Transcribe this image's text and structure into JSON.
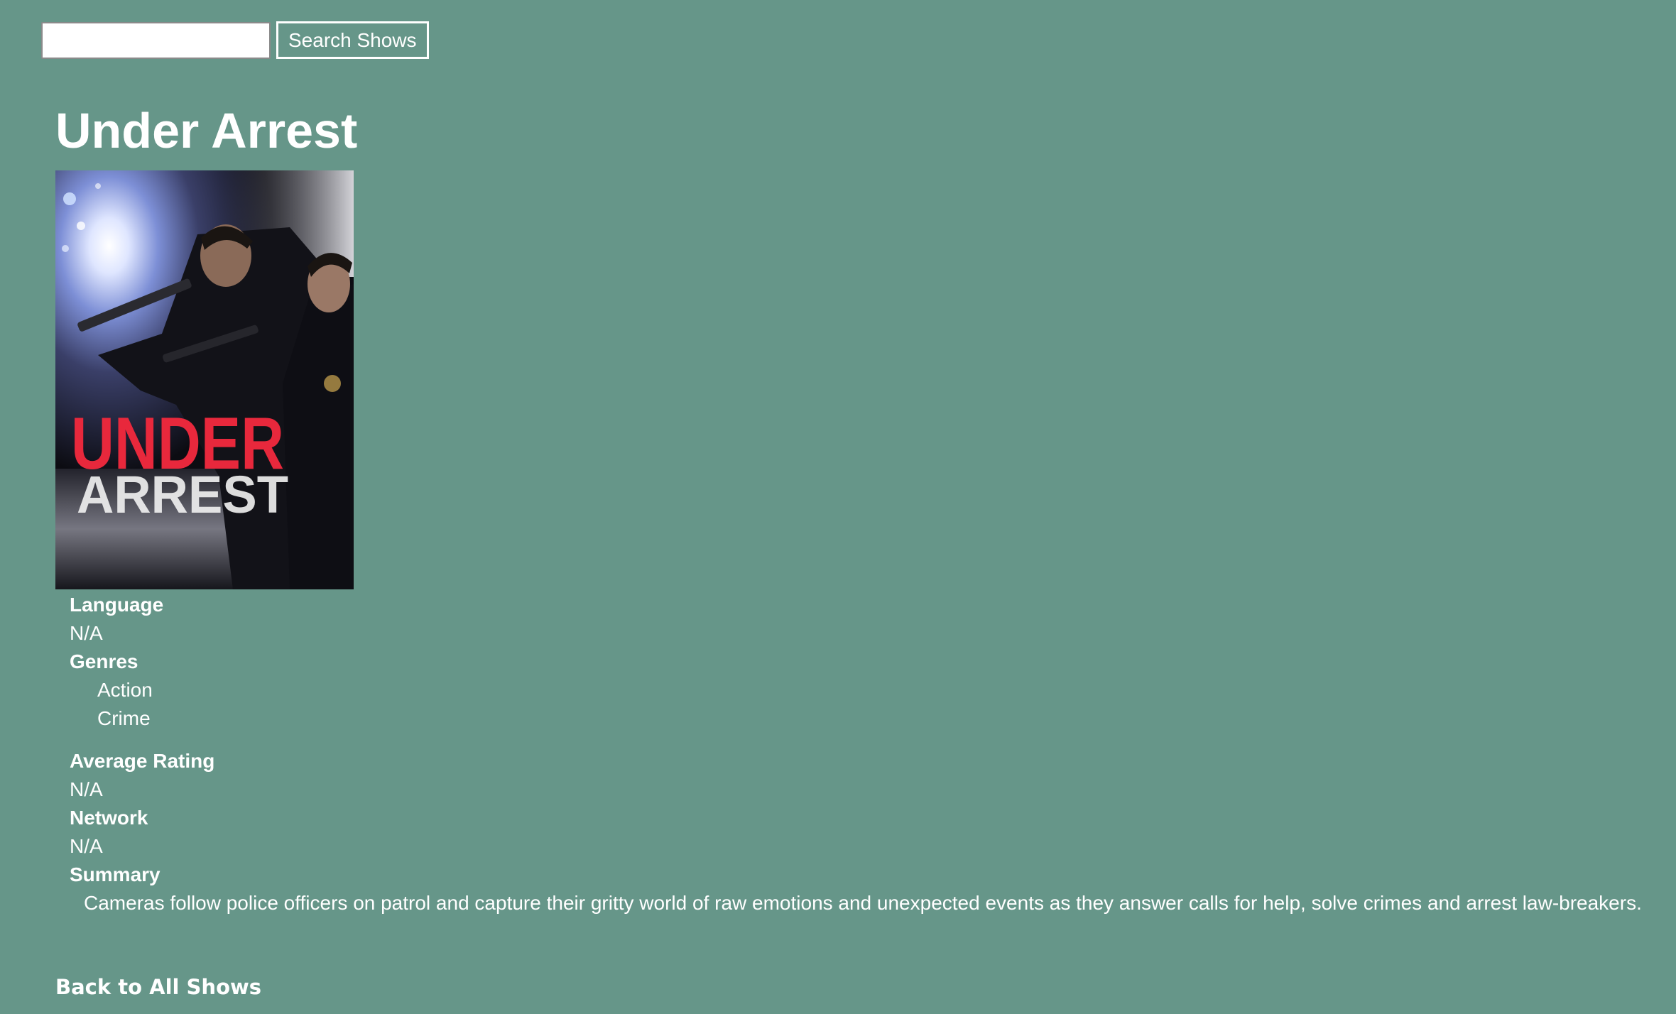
{
  "search": {
    "value": "",
    "placeholder": "",
    "button_label": "Search Shows"
  },
  "show": {
    "title": "Under Arrest",
    "poster": {
      "text_line1": "UNDER",
      "text_line2": "ARREST"
    },
    "language_label": "Language",
    "language": "N/A",
    "genres_label": "Genres",
    "genres": [
      "Action",
      "Crime"
    ],
    "rating_label": "Average Rating",
    "rating": "N/A",
    "network_label": "Network",
    "network": "N/A",
    "summary_label": "Summary",
    "summary": "Cameras follow police officers on patrol and capture their gritty world of raw emotions and unexpected events as they answer calls for help, solve crimes and arrest law-breakers."
  },
  "back_link": "Back to All Shows",
  "colors": {
    "background": "#669689",
    "text": "#ffffff",
    "poster_title": "#e8283c"
  }
}
